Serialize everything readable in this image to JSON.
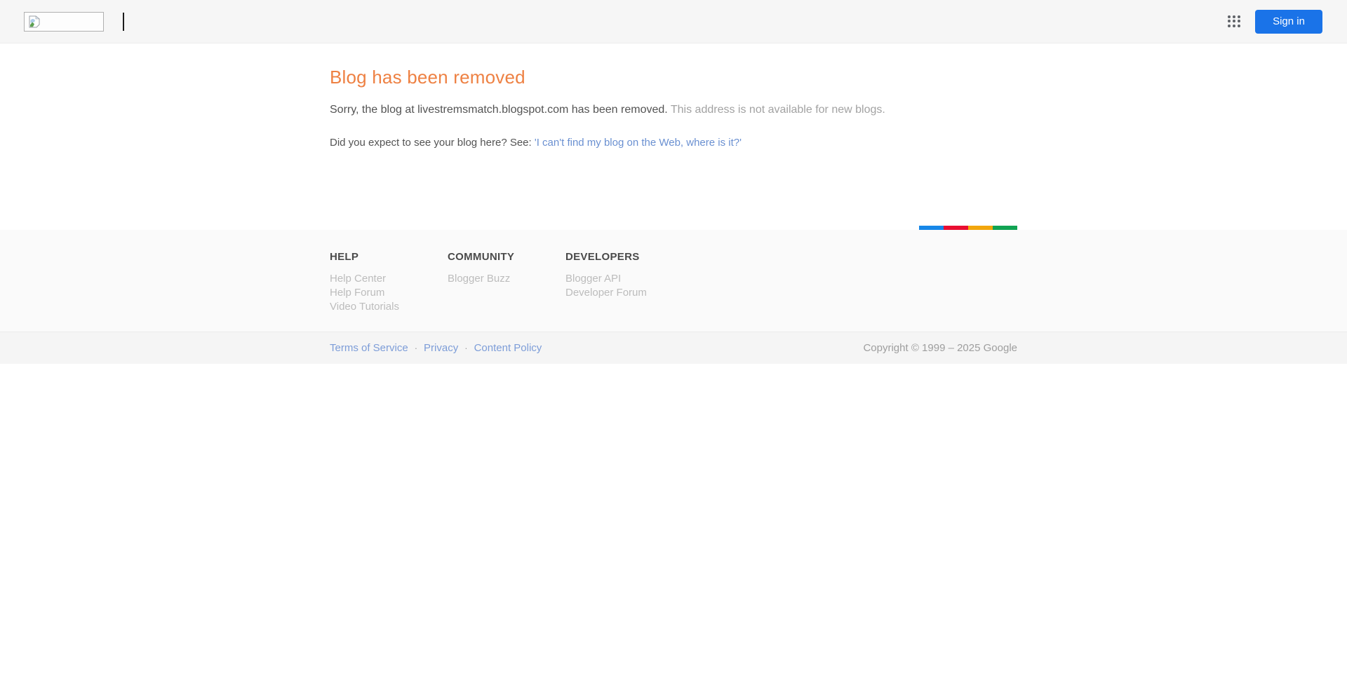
{
  "header": {
    "logo": {
      "icon": "broken-image-icon"
    },
    "caret_glyph": "|",
    "apps_icon": "google-apps-grid-icon",
    "sign_in_label": "Sign in",
    "sign_in_color": "#1a73e8"
  },
  "main": {
    "title": "Blog has been removed",
    "title_color": "#ee8143",
    "message_primary": "Sorry, the blog at livestremsmatch.blogspot.com has been removed.",
    "message_secondary": "This address is not available for new blogs.",
    "prompt_text": "Did you expect to see your blog here? See: ",
    "prompt_link": "'I can't find my blog on the Web, where is it?'"
  },
  "footer": {
    "stripe_colors": [
      "#1787e8",
      "#e90e31",
      "#f2a60c",
      "#11a353"
    ],
    "columns": [
      {
        "heading": "HELP",
        "links": [
          "Help Center",
          "Help Forum",
          "Video Tutorials"
        ]
      },
      {
        "heading": "COMMUNITY",
        "links": [
          "Blogger Buzz"
        ]
      },
      {
        "heading": "DEVELOPERS",
        "links": [
          "Blogger API",
          "Developer Forum"
        ]
      }
    ],
    "legal": {
      "links": [
        "Terms of Service",
        "Privacy",
        "Content Policy"
      ],
      "separator": "·"
    },
    "copyright": "Copyright © 1999 – 2025 Google"
  }
}
